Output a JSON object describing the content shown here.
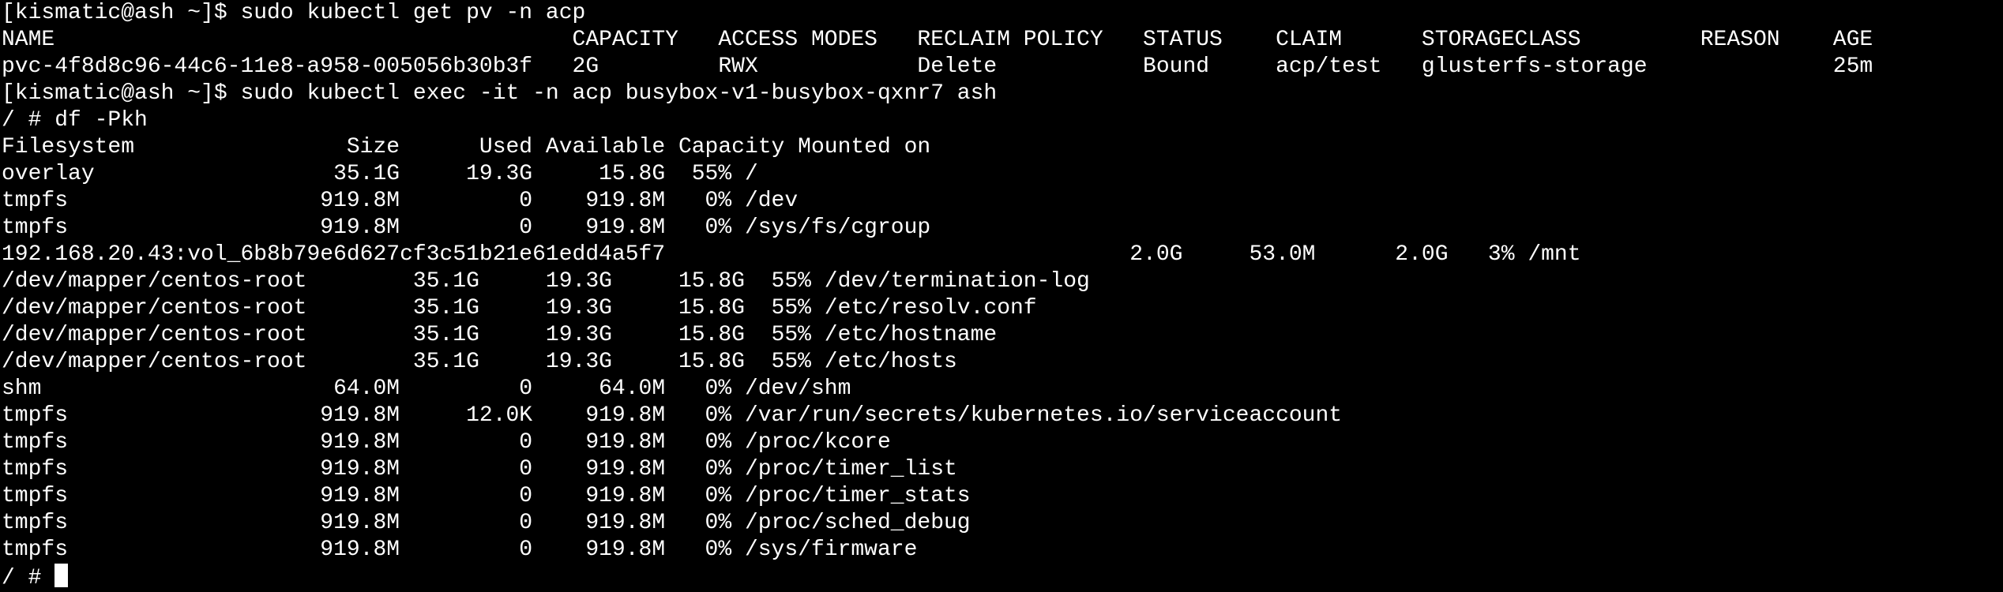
{
  "terminal": {
    "lines": [
      "[kismatic@ash ~]$ sudo kubectl get pv -n acp",
      "NAME                                       CAPACITY   ACCESS MODES   RECLAIM POLICY   STATUS    CLAIM      STORAGECLASS         REASON    AGE",
      "pvc-4f8d8c96-44c6-11e8-a958-005056b30b3f   2G         RWX            Delete           Bound     acp/test   glusterfs-storage              25m",
      "[kismatic@ash ~]$ sudo kubectl exec -it -n acp busybox-v1-busybox-qxnr7 ash",
      "/ # df -Pkh",
      "Filesystem                Size      Used Available Capacity Mounted on",
      "overlay                  35.1G     19.3G     15.8G  55% /",
      "tmpfs                   919.8M         0    919.8M   0% /dev",
      "tmpfs                   919.8M         0    919.8M   0% /sys/fs/cgroup",
      "192.168.20.43:vol_6b8b79e6d627cf3c51b21e61edd4a5f7                                   2.0G     53.0M      2.0G   3% /mnt",
      "/dev/mapper/centos-root        35.1G     19.3G     15.8G  55% /dev/termination-log",
      "/dev/mapper/centos-root        35.1G     19.3G     15.8G  55% /etc/resolv.conf",
      "/dev/mapper/centos-root        35.1G     19.3G     15.8G  55% /etc/hostname",
      "/dev/mapper/centos-root        35.1G     19.3G     15.8G  55% /etc/hosts",
      "shm                      64.0M         0     64.0M   0% /dev/shm",
      "tmpfs                   919.8M     12.0K    919.8M   0% /var/run/secrets/kubernetes.io/serviceaccount",
      "tmpfs                   919.8M         0    919.8M   0% /proc/kcore",
      "tmpfs                   919.8M         0    919.8M   0% /proc/timer_list",
      "tmpfs                   919.8M         0    919.8M   0% /proc/timer_stats",
      "tmpfs                   919.8M         0    919.8M   0% /proc/sched_debug",
      "tmpfs                   919.8M         0    919.8M   0% /sys/firmware"
    ],
    "prompt": "/ # ",
    "colors": {
      "background": "#000000",
      "foreground": "#ffffff",
      "cursor": "#ffffff"
    }
  }
}
